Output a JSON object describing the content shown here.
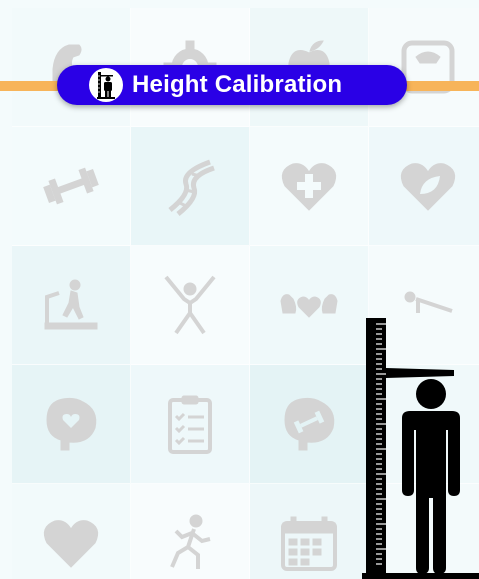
{
  "header": {
    "title": "Height Calibration",
    "logo_icon": "person-on-height-scale-icon",
    "accent_color": "#2a00e6",
    "bar_color": "#f7b45a"
  },
  "background_tiles": [
    [
      "muscle-arm-icon",
      "gear-icon",
      "apple-icon",
      "weighing-scale-icon"
    ],
    [
      "dumbbell-icon",
      "dna-icon",
      "heart-plus-icon",
      "heart-leaf-icon"
    ],
    [
      "treadmill-icon",
      "jumping-person-icon",
      "arms-heart-icon",
      "pushup-icon"
    ],
    [
      "stomach-heart-icon",
      "clipboard-checklist-icon",
      "stomach-dumbbell-icon",
      "blank"
    ],
    [
      "heart-icon",
      "running-person-icon",
      "calendar-icon",
      "blank"
    ]
  ],
  "illustration": "person-on-stadiometer-icon"
}
